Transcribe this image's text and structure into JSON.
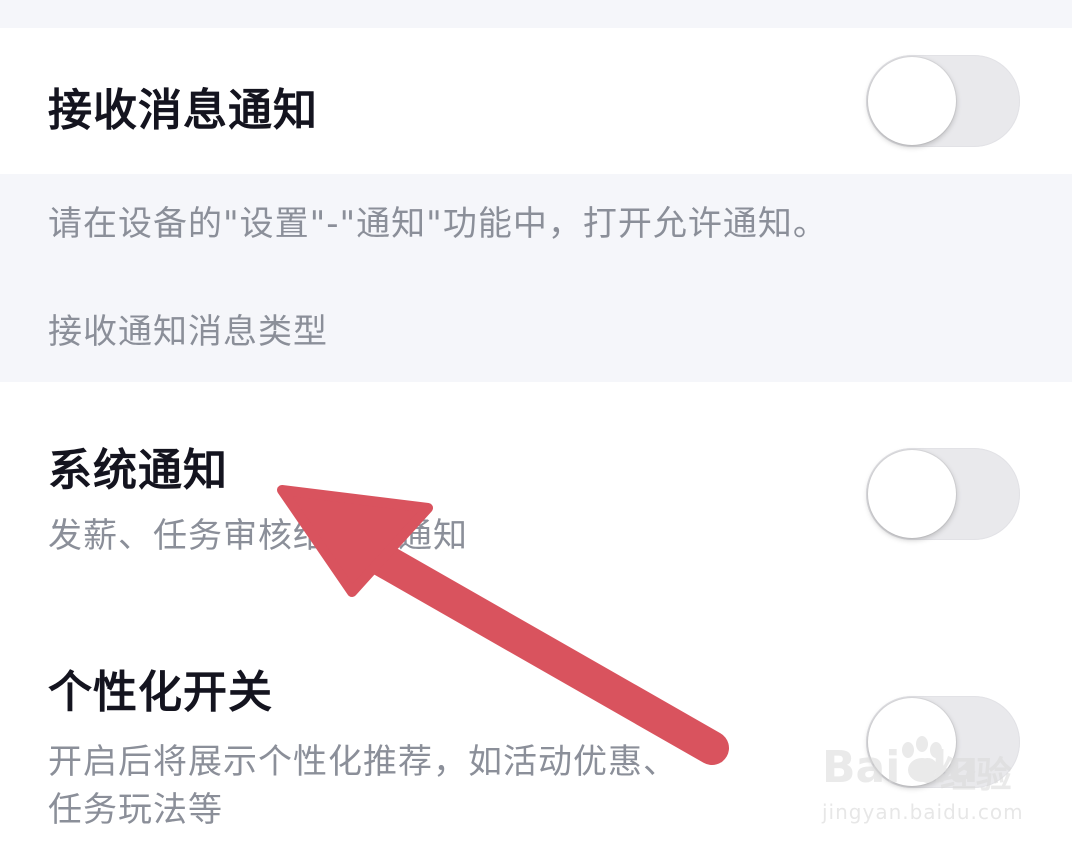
{
  "settings": {
    "receive_notifications": {
      "title": "接收消息通知",
      "enabled": false
    },
    "hint": {
      "permission_text": "请在设备的\"设置\"-\"通知\"功能中，打开允许通知。",
      "section_label": "接收通知消息类型"
    },
    "system_notifications": {
      "title": "系统通知",
      "description": "发薪、任务审核结果等通知",
      "enabled": false
    },
    "personalization": {
      "title": "个性化开关",
      "description_line1": "开启后将展示个性化推荐，如活动优惠、",
      "description_line2": "任务玩法等",
      "enabled": false
    }
  },
  "annotation": {
    "type": "arrow",
    "color": "#d9535e",
    "points_to": "系统通知"
  },
  "watermark": {
    "logo": "Bai du",
    "brand": "经验",
    "url": "jingyan.baidu.com"
  },
  "colors": {
    "background": "#ffffff",
    "panel": "#f5f6fa",
    "title_text": "#14141f",
    "secondary_text": "#8b8f99",
    "toggle_off": "#e9e9ec"
  }
}
